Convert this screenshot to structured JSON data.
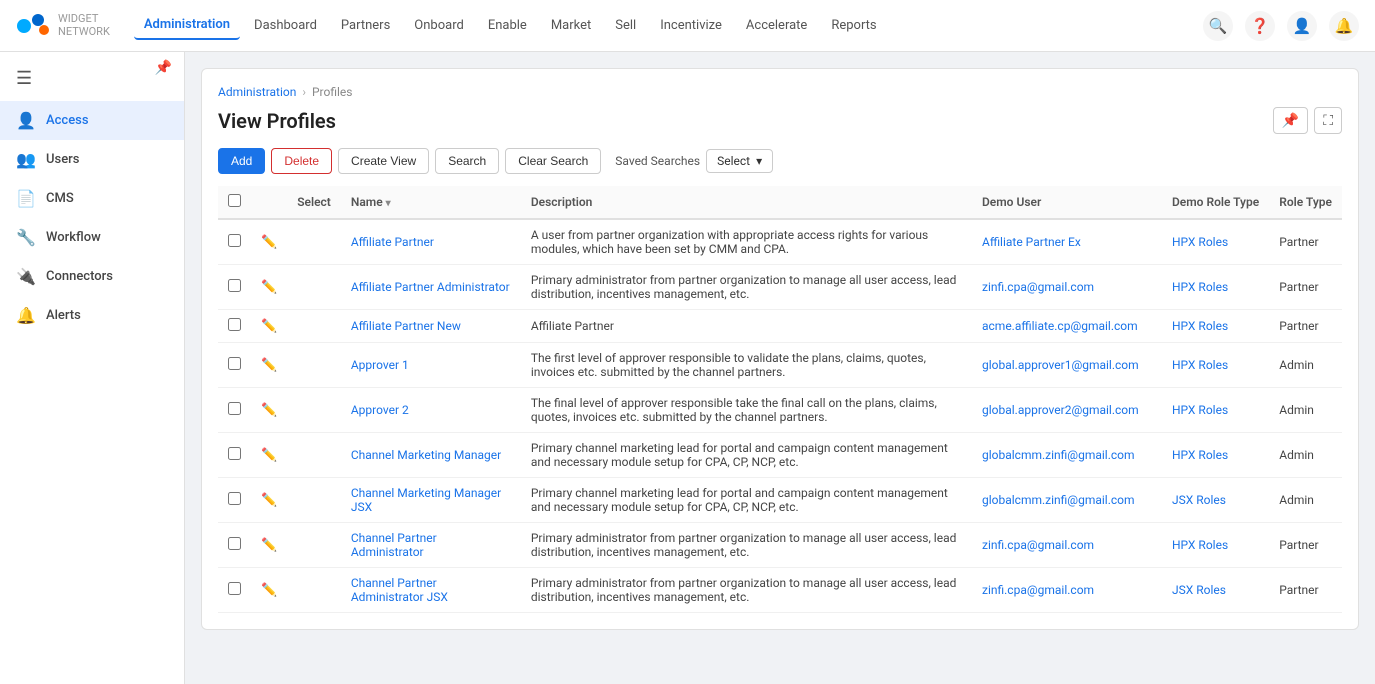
{
  "app": {
    "logo_line1": "WIDGET",
    "logo_line2": "NETWORK"
  },
  "nav": {
    "links": [
      {
        "id": "administration",
        "label": "Administration",
        "active": true
      },
      {
        "id": "dashboard",
        "label": "Dashboard",
        "active": false
      },
      {
        "id": "partners",
        "label": "Partners",
        "active": false
      },
      {
        "id": "onboard",
        "label": "Onboard",
        "active": false
      },
      {
        "id": "enable",
        "label": "Enable",
        "active": false
      },
      {
        "id": "market",
        "label": "Market",
        "active": false
      },
      {
        "id": "sell",
        "label": "Sell",
        "active": false
      },
      {
        "id": "incentivize",
        "label": "Incentivize",
        "active": false
      },
      {
        "id": "accelerate",
        "label": "Accelerate",
        "active": false
      },
      {
        "id": "reports",
        "label": "Reports",
        "active": false
      }
    ]
  },
  "sidebar": {
    "items": [
      {
        "id": "access",
        "label": "Access",
        "icon": "👤",
        "active": true
      },
      {
        "id": "users",
        "label": "Users",
        "icon": "👥",
        "active": false
      },
      {
        "id": "cms",
        "label": "CMS",
        "icon": "📄",
        "active": false
      },
      {
        "id": "workflow",
        "label": "Workflow",
        "icon": "🔧",
        "active": false
      },
      {
        "id": "connectors",
        "label": "Connectors",
        "icon": "🔌",
        "active": false
      },
      {
        "id": "alerts",
        "label": "Alerts",
        "icon": "🔔",
        "active": false
      }
    ]
  },
  "breadcrumb": {
    "parent": "Administration",
    "current": "Profiles"
  },
  "page": {
    "title": "View Profiles"
  },
  "toolbar": {
    "add": "Add",
    "delete": "Delete",
    "create_view": "Create View",
    "search": "Search",
    "clear_search": "Clear Search",
    "saved_searches": "Saved Searches",
    "select": "Select"
  },
  "table": {
    "columns": [
      {
        "id": "check",
        "label": ""
      },
      {
        "id": "edit",
        "label": ""
      },
      {
        "id": "select",
        "label": "Select"
      },
      {
        "id": "name",
        "label": "Name"
      },
      {
        "id": "description",
        "label": "Description"
      },
      {
        "id": "demo_user",
        "label": "Demo User"
      },
      {
        "id": "demo_role_type",
        "label": "Demo Role Type"
      },
      {
        "id": "role_type",
        "label": "Role Type"
      }
    ],
    "rows": [
      {
        "name": "Affiliate Partner",
        "description": "A user from partner organization with appropriate access rights for various modules, which have been set by CMM and CPA.",
        "demo_user": "Affiliate Partner Ex",
        "demo_role_type": "HPX Roles",
        "role_type": "Partner"
      },
      {
        "name": "Affiliate Partner Administrator",
        "description": "Primary administrator from partner organization to manage all user access, lead distribution, incentives management, etc.",
        "demo_user": "zinfi.cpa@gmail.com",
        "demo_role_type": "HPX Roles",
        "role_type": "Partner"
      },
      {
        "name": "Affiliate Partner New",
        "description": "Affiliate Partner",
        "demo_user": "acme.affiliate.cp@gmail.com",
        "demo_role_type": "HPX Roles",
        "role_type": "Partner"
      },
      {
        "name": "Approver 1",
        "description": "The first level of approver responsible to validate the plans, claims, quotes, invoices etc. submitted by the channel partners.",
        "demo_user": "global.approver1@gmail.com",
        "demo_role_type": "HPX Roles",
        "role_type": "Admin"
      },
      {
        "name": "Approver 2",
        "description": "The final level of approver responsible take the final call on the plans, claims, quotes, invoices etc. submitted by the channel partners.",
        "demo_user": "global.approver2@gmail.com",
        "demo_role_type": "HPX Roles",
        "role_type": "Admin"
      },
      {
        "name": "Channel Marketing Manager",
        "description": "Primary channel marketing lead for portal and campaign content management and necessary module setup for CPA, CP, NCP, etc.",
        "demo_user": "globalcmm.zinfi@gmail.com",
        "demo_role_type": "HPX Roles",
        "role_type": "Admin"
      },
      {
        "name": "Channel Marketing Manager JSX",
        "description": "Primary channel marketing lead for portal and campaign content management and necessary module setup for CPA, CP, NCP, etc.",
        "demo_user": "globalcmm.zinfi@gmail.com",
        "demo_role_type": "JSX Roles",
        "role_type": "Admin"
      },
      {
        "name": "Channel Partner Administrator",
        "description": "Primary administrator from partner organization to manage all user access, lead distribution, incentives management, etc.",
        "demo_user": "zinfi.cpa@gmail.com",
        "demo_role_type": "HPX Roles",
        "role_type": "Partner"
      },
      {
        "name": "Channel Partner Administrator JSX",
        "description": "Primary administrator from partner organization to manage all user access, lead distribution, incentives management, etc.",
        "demo_user": "zinfi.cpa@gmail.com",
        "demo_role_type": "JSX Roles",
        "role_type": "Partner"
      }
    ]
  }
}
